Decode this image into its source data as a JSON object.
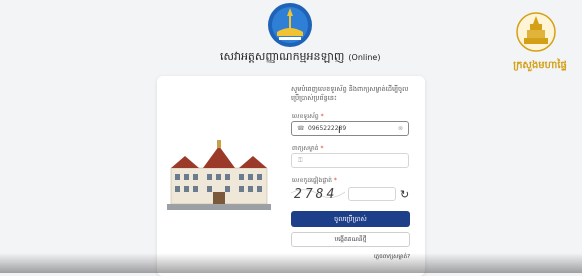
{
  "header": {
    "title": "សេវាអត្តសញ្ញាណកម្មអនឡាញ",
    "title_suffix": "(Online)",
    "brand_name": "ក្រសួងមហាផ្ទៃ"
  },
  "form": {
    "intro_text": "សូមបំពេញលេខទូរស័ព្ទ និងពាក្យសម្ងាត់ដើម្បីចូលប្រើប្រាស់ប្រព័ន្ធនេះ",
    "phone": {
      "label": "លេខទូរស័ព្ទ",
      "required_mark": "*",
      "value": "0965222289",
      "icon": "phone-icon"
    },
    "password": {
      "label": "ពាក្យសម្ងាត់",
      "required_mark": "*",
      "placeholder": "",
      "icon": "lock-icon"
    },
    "captcha": {
      "label": "លេខកូដផ្ទៀងផ្ទាត់",
      "required_mark": "*",
      "code": "2784",
      "input_value": "",
      "refresh_icon": "refresh-icon"
    },
    "login_button": "ចូលប្រើប្រាស់",
    "register_button": "បង្កើតគណនីថ្មី",
    "forgot_link": "ភ្លេចពាក្យសម្ងាត់?"
  },
  "colors": {
    "primary_button": "#1d3f8a",
    "brand_gold": "#d4a017",
    "required": "#e53935"
  }
}
